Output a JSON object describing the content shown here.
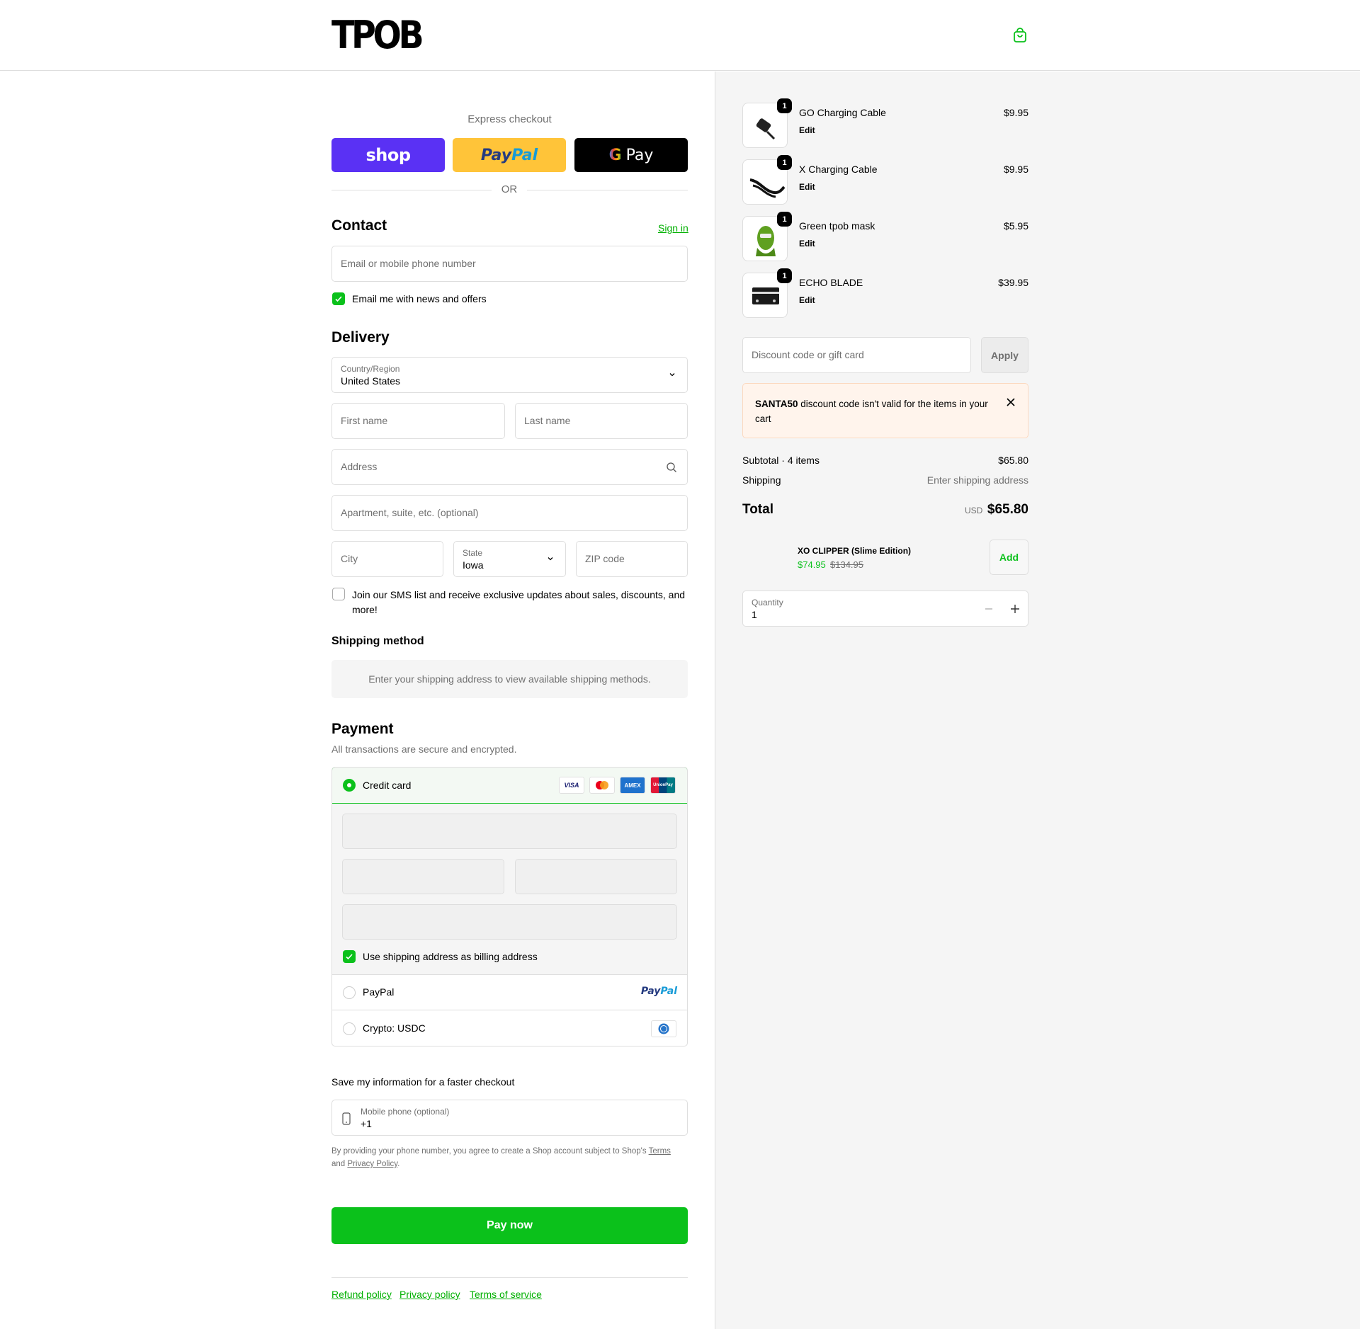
{
  "brand": {
    "logo": "TPOB",
    "accent": "#0bc11b"
  },
  "express": {
    "label": "Express checkout",
    "shop": "shop",
    "paypal_a": "Pay",
    "paypal_b": "Pal",
    "gpay_g": "G",
    "gpay": "Pay",
    "or": "OR"
  },
  "contact": {
    "heading": "Contact",
    "signin": "Sign in",
    "email_placeholder": "Email or mobile phone number",
    "newsletter": "Email me with news and offers"
  },
  "delivery": {
    "heading": "Delivery",
    "country_label": "Country/Region",
    "country": "United States",
    "first_name": "First name",
    "last_name": "Last name",
    "address": "Address",
    "apartment": "Apartment, suite, etc. (optional)",
    "city": "City",
    "state_label": "State",
    "state": "Iowa",
    "zip": "ZIP code",
    "sms": "Join our SMS list and receive exclusive updates about sales, discounts, and more!"
  },
  "shipping": {
    "heading": "Shipping method",
    "message": "Enter your shipping address to view available shipping methods."
  },
  "payment": {
    "heading": "Payment",
    "subtext": "All transactions are secure and encrypted.",
    "credit_card": "Credit card",
    "cards": [
      "VISA",
      "MC",
      "AMEX",
      "UnionPay"
    ],
    "billing_same": "Use shipping address as billing address",
    "paypal": "PayPal",
    "paypal_logo_a": "Pay",
    "paypal_logo_b": "Pal",
    "crypto": "Crypto: USDC"
  },
  "save_info": {
    "heading": "Save my information for a faster checkout",
    "phone_label": "Mobile phone (optional)",
    "phone_value": "+1",
    "terms_a": "By providing your phone number, you agree to create a Shop account subject to Shop's ",
    "terms_link": "Terms",
    "terms_b": "and ",
    "privacy_link": "Privacy Policy",
    "terms_c": "."
  },
  "pay_now": "Pay now",
  "footer": {
    "refund": "Refund policy",
    "privacy": "Privacy policy",
    "terms": "Terms of service"
  },
  "cart": {
    "items": [
      {
        "name": "GO Charging Cable",
        "edit": "Edit",
        "price": "$9.95",
        "qty": "1"
      },
      {
        "name": "X Charging Cable",
        "edit": "Edit",
        "price": "$9.95",
        "qty": "1"
      },
      {
        "name": "Green tpob mask",
        "edit": "Edit",
        "price": "$5.95",
        "qty": "1"
      },
      {
        "name": "ECHO BLADE",
        "edit": "Edit",
        "price": "$39.95",
        "qty": "1"
      }
    ],
    "discount_placeholder": "Discount code or gift card",
    "apply": "Apply",
    "alert_code": "SANTA50",
    "alert_text": " discount code isn't valid for the items in your cart",
    "subtotal_label": "Subtotal · 4 items",
    "subtotal": "$65.80",
    "shipping_label": "Shipping",
    "shipping_value": "Enter shipping address",
    "total_label": "Total",
    "currency": "USD",
    "total": "$65.80",
    "upsell": {
      "name": "XO CLIPPER (Slime Edition)",
      "price": "$74.95",
      "old_price": "$134.95",
      "add": "Add"
    },
    "quantity_label": "Quantity",
    "quantity": "1"
  }
}
